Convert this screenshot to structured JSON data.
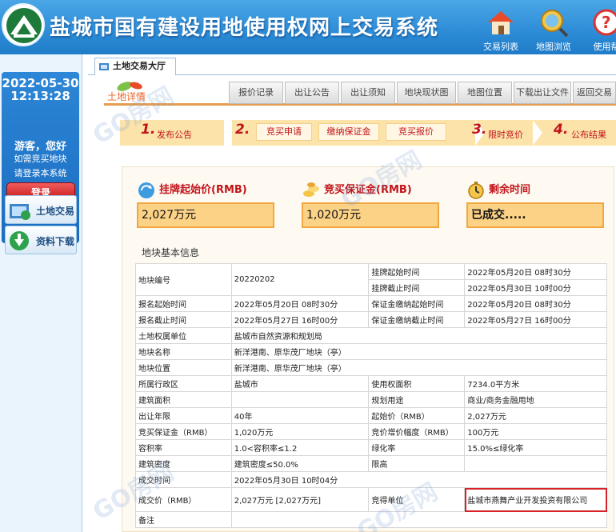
{
  "header": {
    "title": "盐城市国有建设用地使用权网上交易系统",
    "buttons": [
      {
        "label": "交易列表"
      },
      {
        "label": "地图浏览"
      },
      {
        "label": "使用帮"
      }
    ]
  },
  "left": {
    "date": "2022-05-30",
    "time": "12:13:28",
    "welcome": "游客，您好",
    "link1": "如需竞买地块",
    "link2": "请登录本系统",
    "login": "登录",
    "nav": [
      {
        "label": "土地交易"
      },
      {
        "label": "资料下载"
      }
    ]
  },
  "toptab": {
    "label": "土地交易大厅"
  },
  "subtabs": {
    "active": "土地详情",
    "items": [
      "报价记录",
      "出让公告",
      "出让须知",
      "地块现状图",
      "地图位置",
      "下载出让文件",
      "返回交易大"
    ]
  },
  "steps": {
    "s1": {
      "num": "1.",
      "label": "发布公告"
    },
    "s2": {
      "num": "2.",
      "subs": [
        "竞买申请",
        "缴纳保证金",
        "竞买报价"
      ]
    },
    "s3": {
      "num": "3.",
      "label": "限时竞价"
    },
    "s4": {
      "num": "4.",
      "label": "公布结果"
    }
  },
  "cards": {
    "start_price": {
      "title": "挂牌起始价(RMB)",
      "value": "2,027万元"
    },
    "deposit": {
      "title": "竞买保证金(RMB)",
      "value": "1,020万元"
    },
    "remaining": {
      "title": "剩余时间",
      "value": "已成交....."
    }
  },
  "section_title": "地块基本信息",
  "table": {
    "r1": {
      "k": "地块编号",
      "v": "20220202",
      "k2a": "挂牌起始时间",
      "v2a": "2022年05月20日 08时30分",
      "k2b": "挂牌截止时间",
      "v2b": "2022年05月30日 10时00分"
    },
    "r2": {
      "k": "报名起始时间",
      "v": "2022年05月20日 08时30分",
      "k2": "保证金缴纳起始时间",
      "v2": "2022年05月20日 08时30分"
    },
    "r3": {
      "k": "报名截止时间",
      "v": "2022年05月27日 16时00分",
      "k2": "保证金缴纳截止时间",
      "v2": "2022年05月27日 16时00分"
    },
    "r4": {
      "k": "土地权属单位",
      "v": "盐城市自然资源和规划局"
    },
    "r5": {
      "k": "地块名称",
      "v": "新洋港南、原华茂厂地块（亭）"
    },
    "r6": {
      "k": "地块位置",
      "v": "新洋港南、原华茂厂地块（亭）"
    },
    "r7": {
      "k": "所属行政区",
      "v": "盐城市",
      "k2": "使用权面积",
      "v2": "7234.0平方米"
    },
    "r8": {
      "k": "建筑面积",
      "v": "",
      "k2": "规划用途",
      "v2": "商业/商务金融用地"
    },
    "r9": {
      "k": "出让年限",
      "v": "40年",
      "k2": "起始价（RMB）",
      "v2": "2,027万元"
    },
    "r10": {
      "k": "竞买保证金（RMB）",
      "v": "1,020万元",
      "k2": "竞价增价幅度（RMB）",
      "v2": "100万元"
    },
    "r11": {
      "k": "容积率",
      "v": "1.0<容积率≤1.2",
      "k2": "绿化率",
      "v2": "15.0%≤绿化率"
    },
    "r12": {
      "k": "建筑密度",
      "v": "建筑密度≤50.0%",
      "k2": "限高",
      "v2": ""
    },
    "r13": {
      "k": "成交时间",
      "v": "2022年05月30日 10时04分"
    },
    "r14": {
      "k": "成交价（RMB）",
      "v": "2,027万元 [2,027万元]",
      "k2": "竞得单位",
      "v2": "盐城市燕舞产业开发投资有限公司"
    },
    "r15": {
      "k": "备注"
    }
  },
  "watermark": "GO房网",
  "colors": {
    "header": "#2f8ed8",
    "accent": "#c1141a",
    "step_bg": "#fbe3aa",
    "value_bg": "#fcd386",
    "highlight": "#d9252a"
  }
}
